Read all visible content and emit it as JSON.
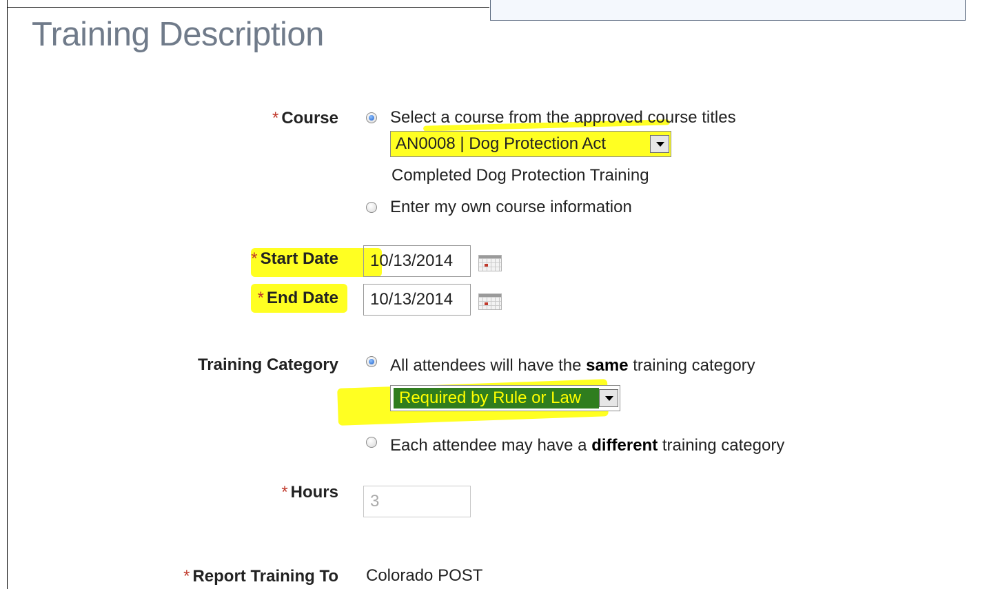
{
  "page": {
    "title": "Training Description"
  },
  "required_marker": "*",
  "course": {
    "label": "Course",
    "option_select": "Select a course from the approved course titles",
    "selected_course": "AN0008 | Dog Protection Act",
    "course_description": "Completed Dog Protection Training",
    "option_own": "Enter my own course information"
  },
  "start_date": {
    "label": "Start Date",
    "value": "10/13/2014"
  },
  "end_date": {
    "label": "End Date",
    "value": "10/13/2014"
  },
  "training_category": {
    "label": "Training Category",
    "option_same_prefix": "All attendees will have the",
    "option_same_bold": "same",
    "option_same_suffix": "training category",
    "selected_category": "Required by Rule or Law",
    "option_different_prefix": "Each attendee may have a",
    "option_different_bold": "different",
    "option_different_suffix": "training category"
  },
  "hours": {
    "label": "Hours",
    "value": "3"
  },
  "report_training_to": {
    "label": "Report Training To",
    "value": "Colorado POST"
  },
  "colors": {
    "highlight": "#ffff22",
    "category_select_bg": "#2f7d1e",
    "category_select_text": "#ffff00",
    "title": "#707b8a",
    "required": "#c0392b"
  }
}
